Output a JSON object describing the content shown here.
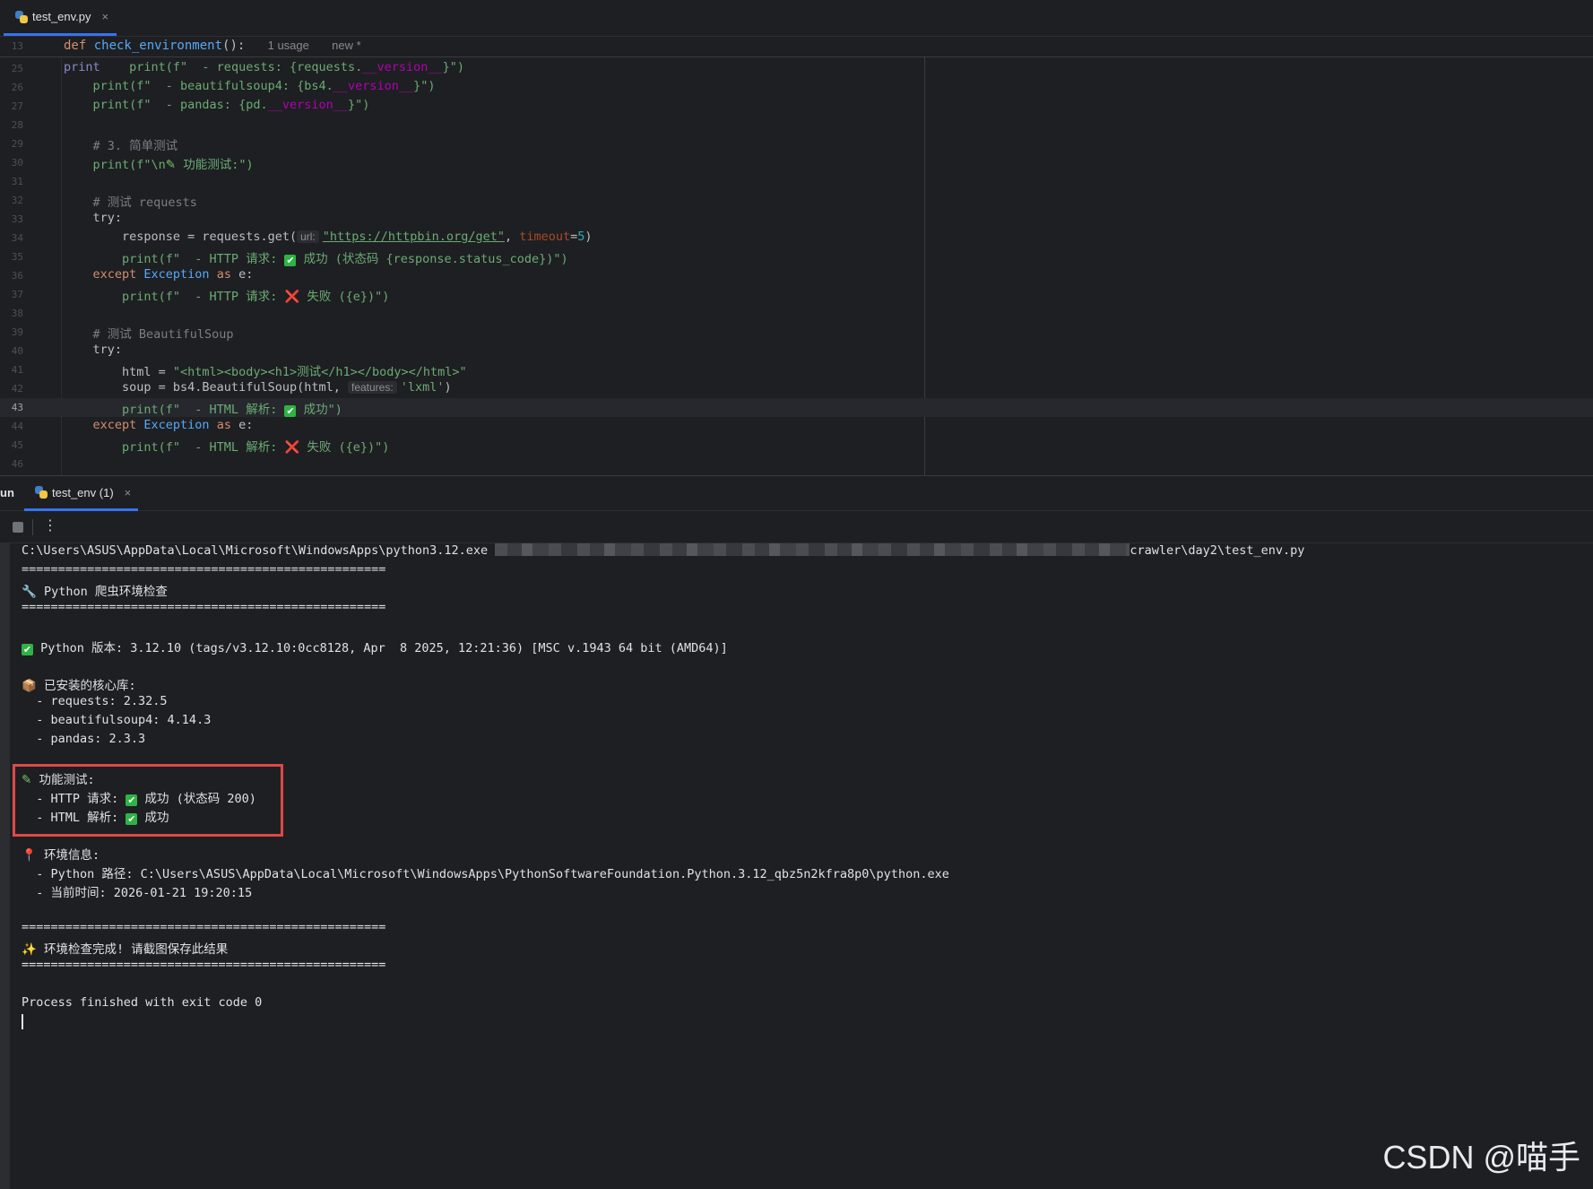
{
  "editor": {
    "tab": {
      "name": "test_env.py",
      "close": "×"
    },
    "sticky": {
      "line": "13",
      "kw": "def ",
      "func": "check_environment",
      "rest": "():",
      "usage": "1 usage",
      "new": "new *"
    },
    "code": {
      "25": {
        "pre": "    print(f\"  - requests: {requests.",
        "attr": "__version__",
        "post": "}\")"
      },
      "26": {
        "pre": "    print(f\"  - beautifulsoup4: {bs4.",
        "attr": "__version__",
        "post": "}\")"
      },
      "27": {
        "pre": "    print(f\"  - pandas: {pd.",
        "attr": "__version__",
        "post": "}\")"
      },
      "29": {
        "comment": "    # 3. 简单测试"
      },
      "30": {
        "pre": "    print(f\"\\n",
        "post": " 功能测试:\")"
      },
      "32": {
        "comment": "    # 测试 requests"
      },
      "33": {
        "kw": "    try:"
      },
      "34": {
        "pre": "        response = requests.get(",
        "chip": "url:",
        "url": "\"https://httpbin.org/get\"",
        "mid": ", ",
        "param": "timeout",
        "eq": "=",
        "num": "5",
        "post": ")"
      },
      "35": {
        "pre": "        print(f\"  - HTTP 请求: ",
        "post": " 成功 (状态码 {response.status_code})\")"
      },
      "36": {
        "kw": "    except ",
        "cls": "Exception",
        "as": " as ",
        "rest": "e:"
      },
      "37": {
        "pre": "        print(f\"  - HTTP 请求: ",
        "cross": "❌",
        "post": " 失败 ({e})\")"
      },
      "39": {
        "comment": "    # 测试 BeautifulSoup"
      },
      "40": {
        "kw": "    try:"
      },
      "41": {
        "pre": "        html = ",
        "str": "\"<html><body><h1>测试</h1></body></html>\""
      },
      "42": {
        "pre": "        soup = bs4.BeautifulSoup(html, ",
        "chip": "features:",
        "str": "'lxml'",
        "post": ")"
      },
      "43": {
        "pre": "        print(f\"  - HTML 解析: ",
        "post": " 成功\")"
      },
      "44": {
        "kw": "    except ",
        "cls": "Exception",
        "as": " as ",
        "rest": "e:"
      },
      "45": {
        "pre": "        print(f\"  - HTML 解析: ",
        "cross": "❌",
        "post": " 失败 ({e})\")"
      }
    }
  },
  "run": {
    "label": "un",
    "tab": {
      "name": "test_env (1)",
      "close": "×"
    },
    "console": {
      "cmd_pre": "C:\\Users\\ASUS\\AppData\\Local\\Microsoft\\WindowsApps\\python3.12.exe",
      "cmd_post": "crawler\\day2\\test_env.py",
      "sep": "==================================================",
      "title": " Python 爬虫环境检查",
      "pyver": " Python 版本: 3.12.10 (tags/v3.12.10:0cc8128, Apr  8 2025, 12:21:36) [MSC v.1943 64 bit (AMD64)]",
      "libs_title": " 已安装的核心库:",
      "lib1": "  - requests: 2.32.5",
      "lib2": "  - beautifulsoup4: 4.14.3",
      "lib3": "  - pandas: 2.3.3",
      "func_title": " 功能测试:",
      "http_pre": "  - HTTP 请求: ",
      "http_post": " 成功 (状态码 200)",
      "html_pre": "  - HTML 解析: ",
      "html_post": " 成功",
      "env_title": " 环境信息:",
      "env_path": "  - Python 路径: C:\\Users\\ASUS\\AppData\\Local\\Microsoft\\WindowsApps\\PythonSoftwareFoundation.Python.3.12_qbz5n2kfra8p0\\python.exe",
      "env_time": "  - 当前时间: 2026-01-21 19:20:15",
      "done": " 环境检查完成! 请截图保存此结果",
      "exit": "Process finished with exit code 0"
    }
  },
  "watermark": "CSDN @喵手"
}
